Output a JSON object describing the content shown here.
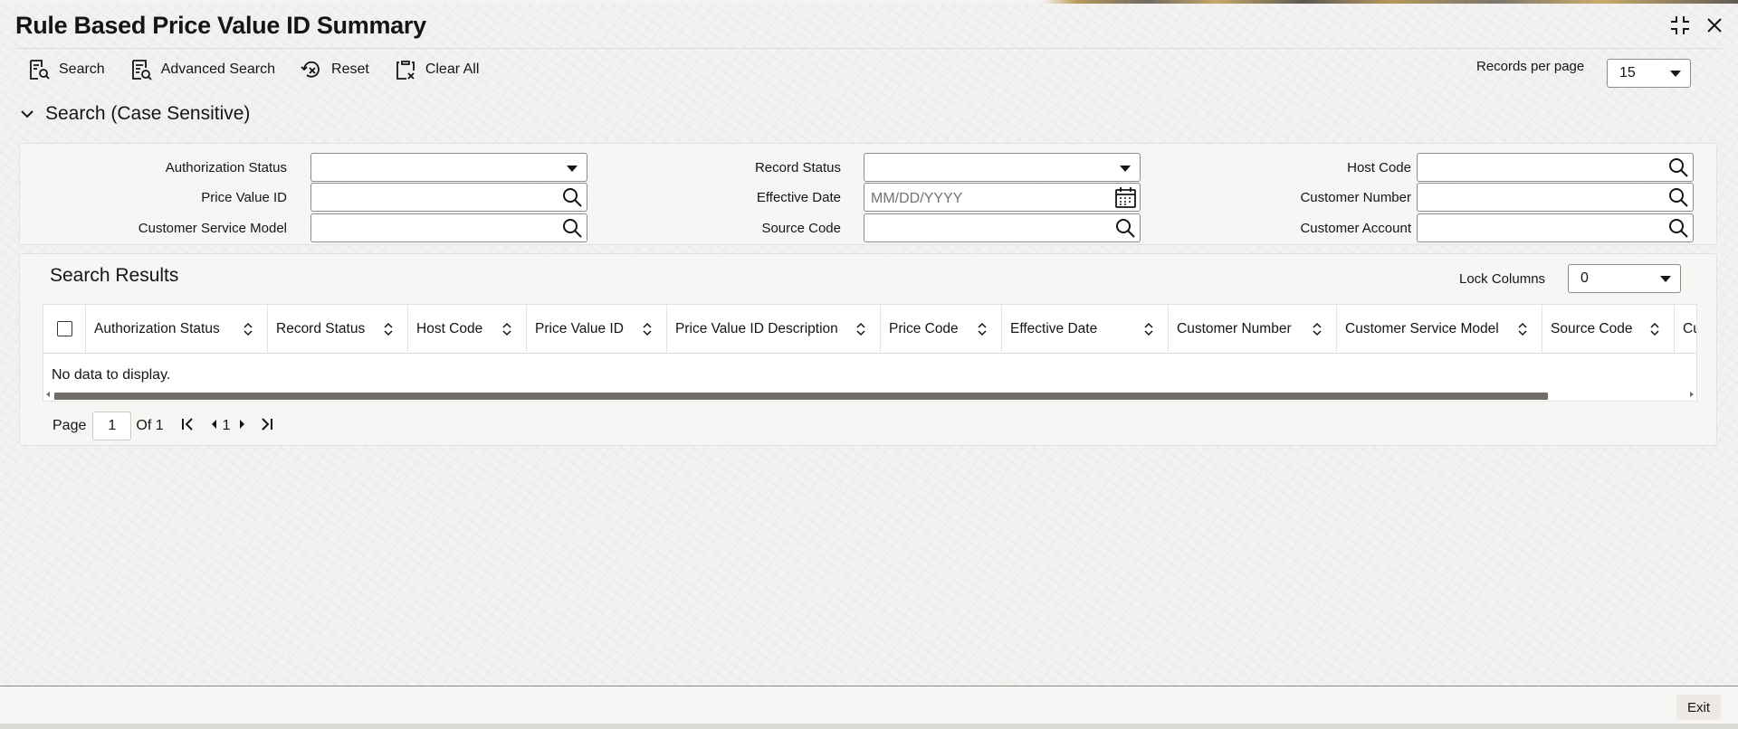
{
  "window": {
    "title": "Rule Based Price Value ID Summary",
    "icons": [
      "collapse-icon",
      "close-icon"
    ]
  },
  "toolbar": {
    "search_label": "Search",
    "advanced_search_label": "Advanced Search",
    "reset_label": "Reset",
    "clear_all_label": "Clear All"
  },
  "records_per_page": {
    "label": "Records per page",
    "value": "15"
  },
  "search_section": {
    "title": "Search (Case Sensitive)"
  },
  "fields": {
    "authorization_status": {
      "label": "Authorization Status",
      "value": ""
    },
    "record_status": {
      "label": "Record Status",
      "value": ""
    },
    "host_code": {
      "label": "Host Code",
      "value": ""
    },
    "price_value_id": {
      "label": "Price Value ID",
      "value": ""
    },
    "effective_date": {
      "label": "Effective Date",
      "placeholder": "MM/DD/YYYY"
    },
    "customer_number": {
      "label": "Customer Number",
      "value": ""
    },
    "customer_service_model": {
      "label": "Customer Service Model",
      "value": ""
    },
    "source_code": {
      "label": "Source Code",
      "value": ""
    },
    "customer_account": {
      "label": "Customer Account",
      "value": ""
    }
  },
  "results": {
    "title": "Search Results",
    "lock_columns": {
      "label": "Lock Columns",
      "value": "0"
    },
    "columns": [
      "Authorization Status",
      "Record Status",
      "Host Code",
      "Price Value ID",
      "Price Value ID Description",
      "Price Code",
      "Effective Date",
      "Customer Number",
      "Customer Service Model",
      "Source Code",
      "Customer Account"
    ],
    "empty_message": "No data to display."
  },
  "pagination": {
    "page_label": "Page",
    "current_page": "1",
    "of_label": "Of 1",
    "page_number": "1"
  },
  "footer": {
    "exit_label": "Exit"
  }
}
